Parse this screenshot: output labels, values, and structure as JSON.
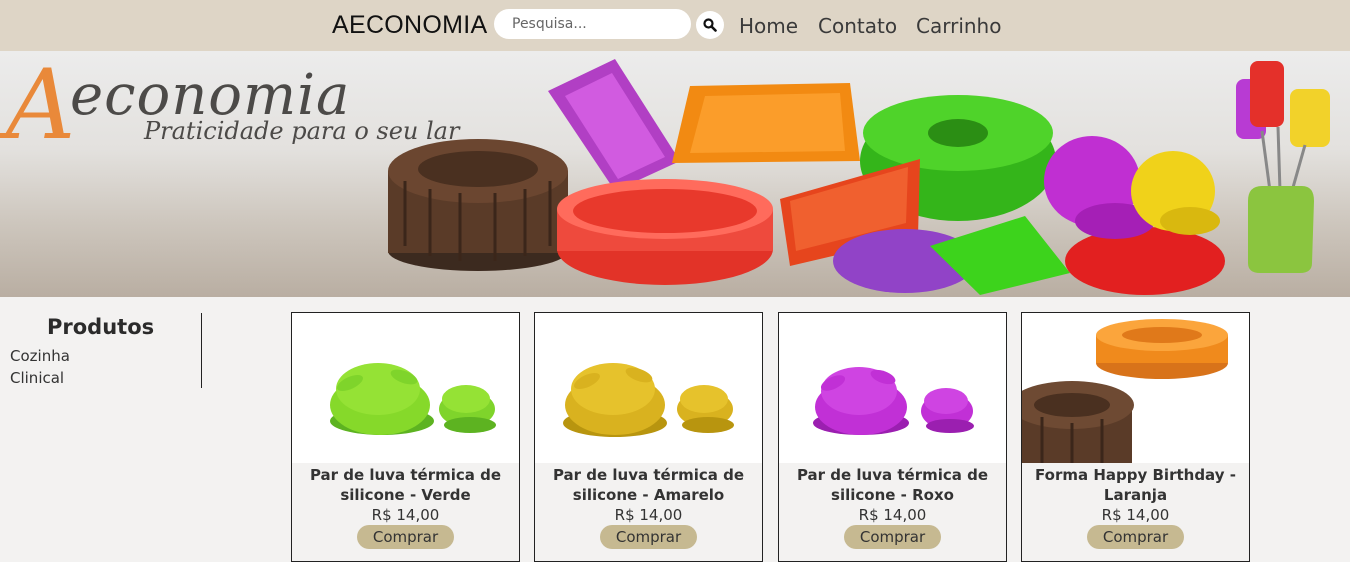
{
  "header": {
    "brand": "AECONOMIA",
    "search_placeholder": "Pesquisa...",
    "nav": [
      "Home",
      "Contato",
      "Carrinho"
    ],
    "background": "#ded5c6"
  },
  "banner": {
    "logo_initial": "A",
    "logo_word": "economia",
    "tagline": "Praticidade para o seu lar"
  },
  "sidebar": {
    "title": "Produtos",
    "categories": [
      "Cozinha",
      "Clinical"
    ]
  },
  "products": [
    {
      "name": "Par de luva térmica de silicone - Verde",
      "price": "R$ 14,00",
      "button": "Comprar",
      "color": "#7fd42b"
    },
    {
      "name": "Par de luva térmica de silicone - Amarelo",
      "price": "R$ 14,00",
      "button": "Comprar",
      "color": "#d9b21f"
    },
    {
      "name": "Par de luva térmica de silicone - Roxo",
      "price": "R$ 14,00",
      "button": "Comprar",
      "color": "#c130d6"
    },
    {
      "name": "Forma Happy Birthday - Laranja",
      "price": "R$ 14,00",
      "button": "Comprar",
      "color": "#f08a1c"
    }
  ],
  "colors": {
    "button": "#c6b991",
    "page_bg": "#f3f2f1"
  }
}
